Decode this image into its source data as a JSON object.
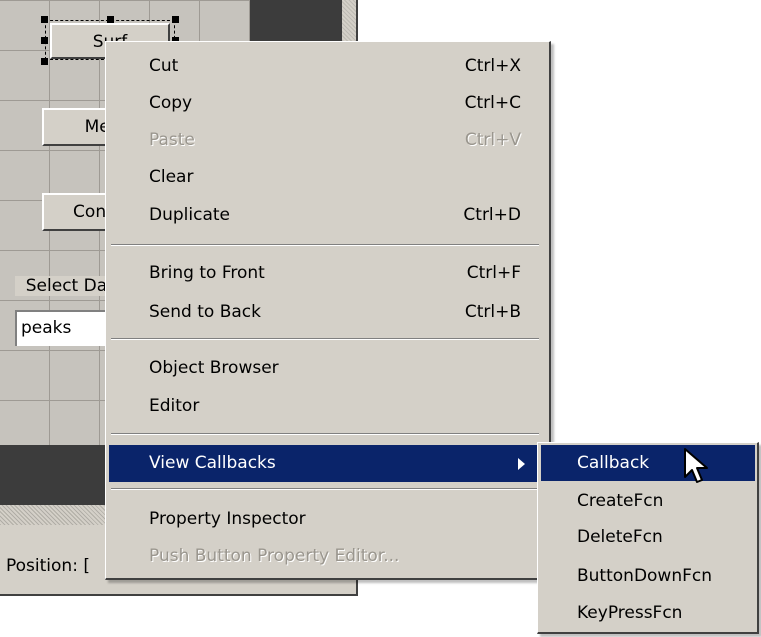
{
  "editor": {
    "buttons": {
      "surf": "Surf",
      "mesh": "Mesh",
      "contour": "Contour"
    },
    "select_label": "Select Data",
    "popup_value": "peaks",
    "status_text": "Position: ["
  },
  "menu": {
    "items": [
      {
        "label": "Cut",
        "accel": "Ctrl+X"
      },
      {
        "label": "Copy",
        "accel": "Ctrl+C"
      },
      {
        "label": "Paste",
        "accel": "Ctrl+V"
      },
      {
        "label": "Clear",
        "accel": ""
      },
      {
        "label": "Duplicate",
        "accel": "Ctrl+D"
      },
      {
        "label": "Bring to Front",
        "accel": "Ctrl+F"
      },
      {
        "label": "Send to Back",
        "accel": "Ctrl+B"
      },
      {
        "label": "Object Browser",
        "accel": ""
      },
      {
        "label": "Editor",
        "accel": ""
      },
      {
        "label": "View Callbacks",
        "accel": ""
      },
      {
        "label": "Property Inspector",
        "accel": ""
      },
      {
        "label": "Push Button Property Editor...",
        "accel": ""
      }
    ]
  },
  "submenu": {
    "items": [
      {
        "label": "Callback"
      },
      {
        "label": "CreateFcn"
      },
      {
        "label": "DeleteFcn"
      },
      {
        "label": "ButtonDownFcn"
      },
      {
        "label": "KeyPressFcn"
      }
    ]
  },
  "colors": {
    "face": "#d4d0c8",
    "highlight": "#0a246a",
    "disabled": "#9a968e"
  }
}
